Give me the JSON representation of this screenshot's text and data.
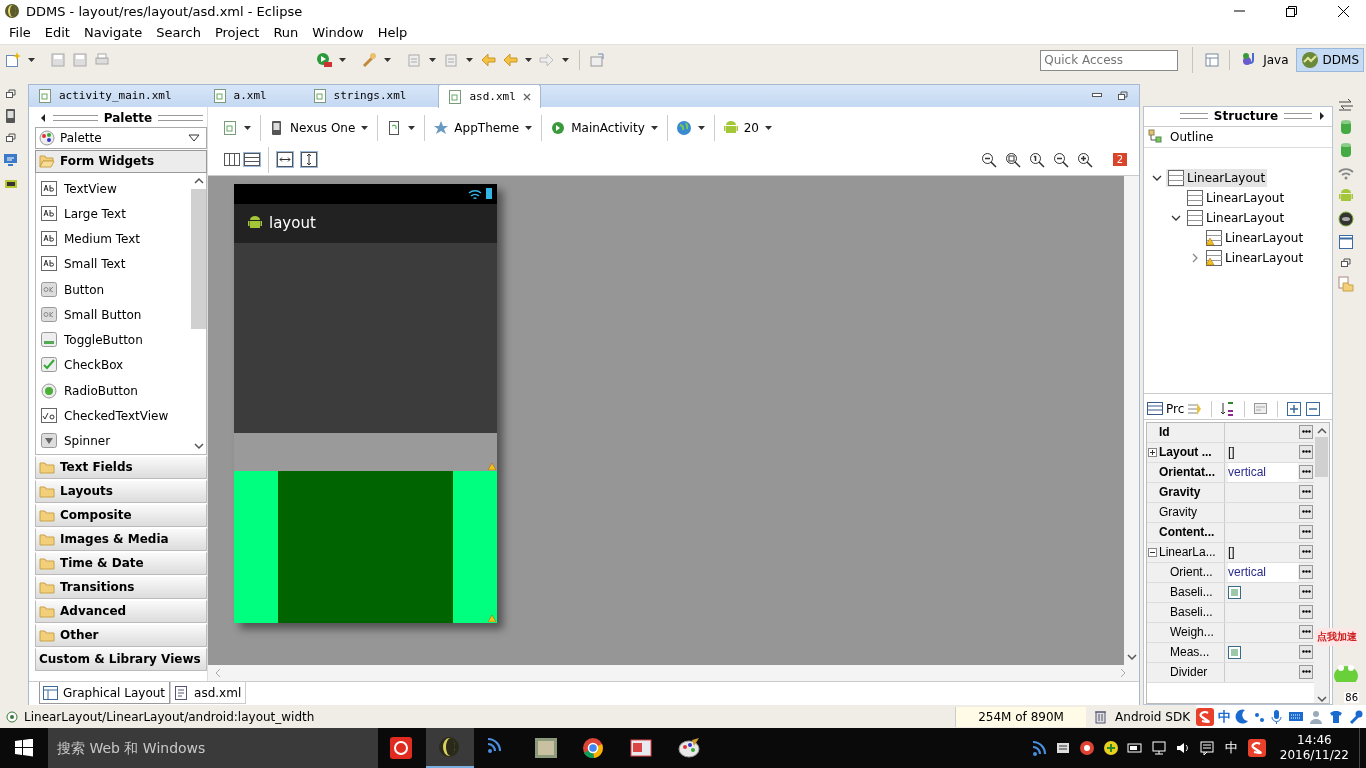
{
  "window": {
    "title": "DDMS - layout/res/layout/asd.xml - Eclipse"
  },
  "menu": [
    "File",
    "Edit",
    "Navigate",
    "Search",
    "Project",
    "Run",
    "Window",
    "Help"
  ],
  "toolbar": {
    "quick_access": {
      "placeholder": "Quick Access"
    },
    "perspectives": [
      {
        "label": "Java",
        "selected": false
      },
      {
        "label": "DDMS",
        "selected": true
      }
    ]
  },
  "editor_tabs": [
    {
      "label": "activity_main.xml",
      "selected": false
    },
    {
      "label": "a.xml",
      "selected": false
    },
    {
      "label": "strings.xml",
      "selected": false
    },
    {
      "label": "asd.xml",
      "selected": true
    }
  ],
  "palette": {
    "title": "Palette",
    "dropdown": "Palette",
    "categories": [
      {
        "label": "Form Widgets",
        "kind": "folder",
        "expanded": true,
        "items": [
          {
            "label": "TextView",
            "kind": "text"
          },
          {
            "label": "Large Text",
            "kind": "text"
          },
          {
            "label": "Medium Text",
            "kind": "text"
          },
          {
            "label": "Small Text",
            "kind": "text"
          },
          {
            "label": "Button",
            "kind": "ok"
          },
          {
            "label": "Small Button",
            "kind": "ok"
          },
          {
            "label": "ToggleButton",
            "kind": "toggle"
          },
          {
            "label": "CheckBox",
            "kind": "check"
          },
          {
            "label": "RadioButton",
            "kind": "radio"
          },
          {
            "label": "CheckedTextView",
            "kind": "checkedtext"
          },
          {
            "label": "Spinner",
            "kind": "spinner"
          }
        ]
      },
      {
        "label": "Text Fields",
        "kind": "folder",
        "expanded": false
      },
      {
        "label": "Layouts",
        "kind": "folder",
        "expanded": false
      },
      {
        "label": "Composite",
        "kind": "folder",
        "expanded": false
      },
      {
        "label": "Images & Media",
        "kind": "folder",
        "expanded": false
      },
      {
        "label": "Time & Date",
        "kind": "folder",
        "expanded": false
      },
      {
        "label": "Transitions",
        "kind": "folder",
        "expanded": false
      },
      {
        "label": "Advanced",
        "kind": "folder",
        "expanded": false
      },
      {
        "label": "Other",
        "kind": "folder",
        "expanded": false
      },
      {
        "label": "Custom & Library Views",
        "kind": "plain",
        "expanded": false
      }
    ]
  },
  "layout_toolbar": {
    "device": "Nexus One",
    "theme": "AppTheme",
    "activity": "MainActivity",
    "api_level": "20",
    "error_count": "2"
  },
  "preview": {
    "app_title": "layout"
  },
  "structure": {
    "title": "Structure",
    "outline_title": "Outline",
    "tree": [
      {
        "label": "LinearLayout",
        "selected": true,
        "warning": false,
        "expanded": true,
        "children": [
          {
            "label": "LinearLayout",
            "selected": false,
            "warning": false
          },
          {
            "label": "LinearLayout",
            "selected": false,
            "warning": false,
            "expanded": true,
            "children": [
              {
                "label": "LinearLayout",
                "selected": false,
                "warning": true
              },
              {
                "label": "LinearLayout",
                "selected": false,
                "warning": true,
                "expanded": false
              }
            ]
          }
        ]
      }
    ]
  },
  "properties": {
    "title": "Prc",
    "rows": [
      {
        "name": "Id",
        "bold": true
      },
      {
        "name": "Layout ...",
        "bold": true,
        "value": "[]",
        "expanded": false
      },
      {
        "name": "Orientat...",
        "bold": true,
        "value": "vertical"
      },
      {
        "name": "Gravity",
        "bold": true
      },
      {
        "name": "Gravity",
        "bold": false
      },
      {
        "name": "Content...",
        "bold": true
      },
      {
        "name": "LinearLa...",
        "bold": false,
        "value": "[]",
        "expanded": true,
        "children": [
          {
            "name": "Orient...",
            "bold": false,
            "value": "vertical"
          },
          {
            "name": "Baseli...",
            "bold": false,
            "kind": "checkbox",
            "checked": false
          },
          {
            "name": "Baseli...",
            "bold": false
          },
          {
            "name": "Weigh...",
            "bold": false
          },
          {
            "name": "Meas...",
            "bold": false,
            "kind": "checkbox",
            "checked": false
          },
          {
            "name": "Divider",
            "bold": false
          }
        ]
      }
    ]
  },
  "bottom_tabs": [
    {
      "label": "Graphical Layout",
      "selected": true
    },
    {
      "label": "asd.xml",
      "selected": false
    }
  ],
  "status_bar": {
    "path": "LinearLayout/LinearLayout/android:layout_width",
    "memory": "254M of 890M",
    "sdk": "Android SDK",
    "ime_mode": "中"
  },
  "overlay": {
    "speedup_badge": "点我加速",
    "counter": "86"
  },
  "taskbar": {
    "search": {
      "placeholder": "搜索 Web 和 Windows"
    },
    "ime_mode": "中",
    "time": "14:46",
    "date": "2016/11/22"
  }
}
